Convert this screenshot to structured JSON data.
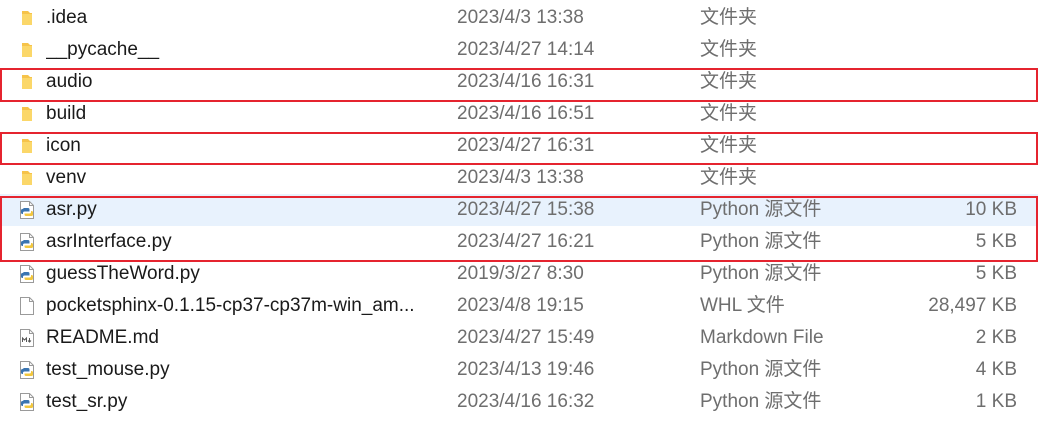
{
  "files": [
    {
      "icon": "folder-icon",
      "name": ".idea",
      "date": "2023/4/3 13:38",
      "type": "文件夹",
      "size": ""
    },
    {
      "icon": "folder-icon",
      "name": "__pycache__",
      "date": "2023/4/27 14:14",
      "type": "文件夹",
      "size": ""
    },
    {
      "icon": "folder-icon",
      "name": "audio",
      "date": "2023/4/16 16:31",
      "type": "文件夹",
      "size": ""
    },
    {
      "icon": "folder-icon",
      "name": "build",
      "date": "2023/4/16 16:51",
      "type": "文件夹",
      "size": ""
    },
    {
      "icon": "folder-icon",
      "name": "icon",
      "date": "2023/4/27 16:31",
      "type": "文件夹",
      "size": ""
    },
    {
      "icon": "folder-icon",
      "name": "venv",
      "date": "2023/4/3 13:38",
      "type": "文件夹",
      "size": ""
    },
    {
      "icon": "python-file-icon",
      "name": "asr.py",
      "date": "2023/4/27 15:38",
      "type": "Python 源文件",
      "size": "10 KB",
      "selected": true
    },
    {
      "icon": "python-file-icon",
      "name": "asrInterface.py",
      "date": "2023/4/27 16:21",
      "type": "Python 源文件",
      "size": "5 KB"
    },
    {
      "icon": "python-file-icon",
      "name": "guessTheWord.py",
      "date": "2019/3/27 8:30",
      "type": "Python 源文件",
      "size": "5 KB"
    },
    {
      "icon": "generic-file-icon",
      "name": "pocketsphinx-0.1.15-cp37-cp37m-win_am...",
      "date": "2023/4/8 19:15",
      "type": "WHL 文件",
      "size": "28,497 KB"
    },
    {
      "icon": "markdown-file-icon",
      "name": "README.md",
      "date": "2023/4/27 15:49",
      "type": "Markdown File",
      "size": "2 KB"
    },
    {
      "icon": "python-file-icon",
      "name": "test_mouse.py",
      "date": "2023/4/13 19:46",
      "type": "Python 源文件",
      "size": "4 KB"
    },
    {
      "icon": "python-file-icon",
      "name": "test_sr.py",
      "date": "2023/4/16 16:32",
      "type": "Python 源文件",
      "size": "1 KB"
    }
  ],
  "colors": {
    "highlight": "#e5242f",
    "selected_row": "#e8f2fd",
    "folder": "#f6c34a",
    "python_blue": "#3a74b0",
    "python_yellow": "#f2c73e"
  }
}
